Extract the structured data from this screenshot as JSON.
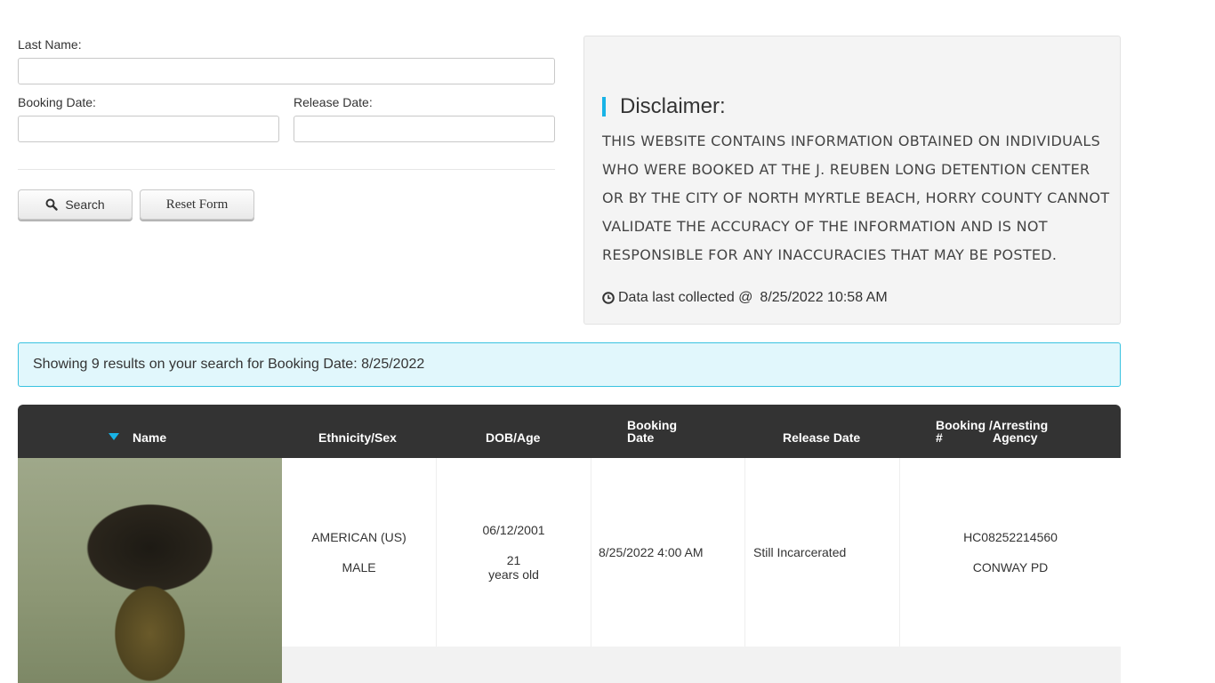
{
  "form": {
    "last_name_label": "Last Name:",
    "last_name_value": "",
    "booking_date_label": "Booking Date:",
    "booking_date_value": "",
    "release_date_label": "Release Date:",
    "release_date_value": "",
    "search_label": "Search",
    "reset_label": "Reset Form"
  },
  "disclaimer": {
    "title": "Disclaimer:",
    "lines": [
      "This website contains information obtained on individuals",
      "who were booked at the J. Reuben Long Detention Center",
      "or by the City of North Myrtle Beach, Horry County cannot",
      "validate the accuracy of the information and is not",
      "responsible for any inaccuracies that may be posted."
    ],
    "collected_label": "Data last collected @",
    "collected_value": "8/25/2022 10:58 AM"
  },
  "results": {
    "summary": "Showing 9 results on your search for Booking Date: 8/25/2022"
  },
  "table": {
    "headers": {
      "name": "Name",
      "ethnicity_sex": "Ethnicity/Sex",
      "dob_age": "DOB/Age",
      "booking_date_1": "Booking",
      "booking_date_2": "Date",
      "release_date": "Release Date",
      "booking_no_1": "Booking",
      "booking_no_2": "#",
      "arresting_1": "/Arresting",
      "arresting_2": "Agency"
    },
    "rows": [
      {
        "ethnicity": "AMERICAN (US)",
        "sex": "MALE",
        "dob": "06/12/2001",
        "age": "21",
        "age_suffix": "years old",
        "booking_date": "8/25/2022 4:00 AM",
        "release_date": "Still Incarcerated",
        "booking_number": "HC08252214560",
        "agency": "CONWAY PD"
      }
    ]
  },
  "colors": {
    "accent": "#18b3e6",
    "header_bg": "#333333",
    "info_bg": "#e1f7fc"
  }
}
